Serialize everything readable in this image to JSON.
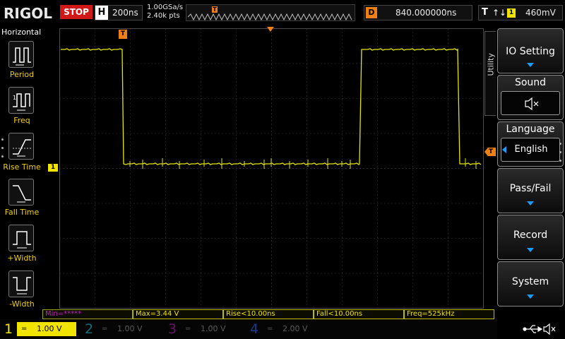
{
  "brand": "RIGOL",
  "run_state": "STOP",
  "horizontal": {
    "label": "H",
    "timebase": "200ns"
  },
  "acquisition": {
    "sample_rate": "1.00GSa/s",
    "points": "2.40k pts"
  },
  "delay": {
    "label": "D",
    "value": "840.000000ns"
  },
  "trigger": {
    "label": "T",
    "channel": "1",
    "level": "460mV",
    "marker": "T"
  },
  "left_panel": {
    "title": "Horizontal",
    "measurements": [
      {
        "label": "Period",
        "icon": "period-icon"
      },
      {
        "label": "Freq",
        "icon": "freq-icon"
      },
      {
        "label": "Rise Time",
        "icon": "rise-time-icon"
      },
      {
        "label": "Fall Time",
        "icon": "fall-time-icon"
      },
      {
        "label": "+Width",
        "icon": "positive-width-icon"
      },
      {
        "label": "-Width",
        "icon": "negative-width-icon"
      }
    ]
  },
  "channel_marker": "1",
  "right_menu": {
    "tab": "Utility",
    "items": [
      {
        "label": "IO Setting"
      },
      {
        "label": "Sound",
        "icon": "speaker-mute-icon"
      },
      {
        "label": "Language",
        "value": "English"
      },
      {
        "label": "Pass/Fail"
      },
      {
        "label": "Record"
      },
      {
        "label": "System"
      }
    ]
  },
  "measurements": [
    {
      "text": "Min=*****"
    },
    {
      "text": "Max=3.44 V"
    },
    {
      "text": "Rise<10.00ns"
    },
    {
      "text": "Fall<10.00ns"
    },
    {
      "text": "Freq=525kHz"
    }
  ],
  "channels": [
    {
      "num": "1",
      "coupling": "=",
      "scale": "1.00 V",
      "active": true,
      "color": "#f0e400"
    },
    {
      "num": "2",
      "coupling": "=",
      "scale": "1.00 V",
      "active": false,
      "color": "#00b8d0"
    },
    {
      "num": "3",
      "coupling": "=",
      "scale": "1.00 V",
      "active": false,
      "color": "#d020d0"
    },
    {
      "num": "4",
      "coupling": "=",
      "scale": "2.00 V",
      "active": false,
      "color": "#2060ff"
    }
  ],
  "status_icons": [
    "usb-icon",
    "speaker-mute-icon"
  ],
  "colors": {
    "trace": "#e6e600",
    "accent": "#f07f16",
    "grid": "#3c3c3c",
    "stop": "#d01818"
  }
}
